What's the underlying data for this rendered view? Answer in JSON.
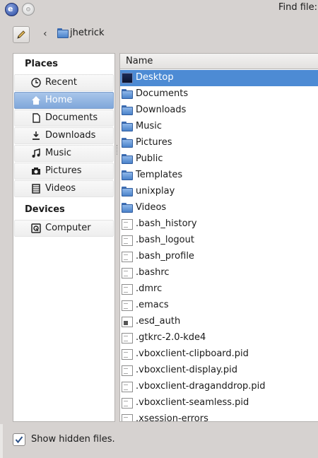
{
  "window": {
    "title": "Find file:"
  },
  "toolbar": {
    "breadcrumb": "jhetrick"
  },
  "places": {
    "section_places": "Places",
    "section_devices": "Devices",
    "items": [
      {
        "label": "Recent",
        "icon": "clock-icon"
      },
      {
        "label": "Home",
        "icon": "home-icon",
        "selected": true
      },
      {
        "label": "Documents",
        "icon": "document-icon"
      },
      {
        "label": "Downloads",
        "icon": "download-icon"
      },
      {
        "label": "Music",
        "icon": "music-icon"
      },
      {
        "label": "Pictures",
        "icon": "camera-icon"
      },
      {
        "label": "Videos",
        "icon": "film-icon"
      }
    ],
    "devices": [
      {
        "label": "Computer",
        "icon": "drive-icon"
      }
    ]
  },
  "filelist": {
    "column_name": "Name",
    "files": [
      {
        "name": "Desktop",
        "type": "desktop",
        "selected": true
      },
      {
        "name": "Documents",
        "type": "folder"
      },
      {
        "name": "Downloads",
        "type": "folder"
      },
      {
        "name": "Music",
        "type": "folder"
      },
      {
        "name": "Pictures",
        "type": "folder"
      },
      {
        "name": "Public",
        "type": "folder"
      },
      {
        "name": "Templates",
        "type": "folder"
      },
      {
        "name": "unixplay",
        "type": "folder"
      },
      {
        "name": "Videos",
        "type": "folder"
      },
      {
        "name": ".bash_history",
        "type": "file"
      },
      {
        "name": ".bash_logout",
        "type": "file"
      },
      {
        "name": ".bash_profile",
        "type": "file"
      },
      {
        "name": ".bashrc",
        "type": "file"
      },
      {
        "name": ".dmrc",
        "type": "file"
      },
      {
        "name": ".emacs",
        "type": "file"
      },
      {
        "name": ".esd_auth",
        "type": "exec"
      },
      {
        "name": ".gtkrc-2.0-kde4",
        "type": "file"
      },
      {
        "name": ".vboxclient-clipboard.pid",
        "type": "file"
      },
      {
        "name": ".vboxclient-display.pid",
        "type": "file"
      },
      {
        "name": ".vboxclient-draganddrop.pid",
        "type": "file"
      },
      {
        "name": ".vboxclient-seamless.pid",
        "type": "file"
      },
      {
        "name": ".xsession-errors",
        "type": "file"
      }
    ]
  },
  "options": {
    "show_hidden_label": "Show hidden files.",
    "show_hidden_checked": true
  },
  "colors": {
    "selection": "#4d8bd4",
    "folder": "#5b8fd0",
    "sidebar_selection": "#8fb2e0"
  }
}
